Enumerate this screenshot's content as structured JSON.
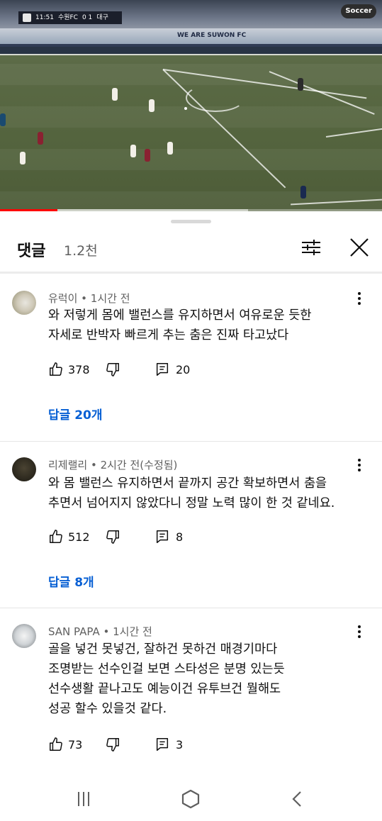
{
  "video": {
    "scorebug": {
      "time": "11:51",
      "home": "수원FC",
      "score": "0 1",
      "away": "대구"
    },
    "channel_logo": "Soccer",
    "ad_text": "WE ARE SUWON FC",
    "progress_fraction": 0.15,
    "buffered_fraction": 0.65
  },
  "sheet": {
    "title": "댓글",
    "count": "1.2천"
  },
  "comments": [
    {
      "author": "유럭이 • 1시간 전",
      "lines": [
        "와 저렇게 몸에 밸런스를 유지하면서 여유로운 듯한",
        "자세로 반박자 빠르게 추는 춤은 진짜 타고났다"
      ],
      "likes": "378",
      "reply_count": "20",
      "replies_label": "답글 20개"
    },
    {
      "author": "리제랠리 • 2시간 전(수정됨)",
      "lines": [
        "와 몸 밸런스 유지하면서 끝까지 공간 확보하면서 춤을",
        "추면서 넘어지지 않았다니 정말 노력 많이 한 것 같네요."
      ],
      "likes": "512",
      "reply_count": "8",
      "replies_label": "답글 8개"
    },
    {
      "author": "SAN PAPA • 1시간 전",
      "lines": [
        "골을 넣건 못넣건, 잘하건 못하건 매경기마다",
        "조명받는 선수인걸 보면 스타성은 분명 있는듯",
        "선수생활 끝나고도 예능이건 유투브건 뭘해도",
        "성공 할수 있을것 같다."
      ],
      "likes": "73",
      "reply_count": "3"
    }
  ],
  "colors": {
    "link_blue": "#065fd4",
    "progress_red": "#ff0000",
    "meta_gray": "#606060"
  },
  "icons": {
    "filter": "sliders-icon",
    "close": "close-icon",
    "more": "more-vertical-icon",
    "like": "thumb-up-icon",
    "dislike": "thumb-down-icon",
    "reply": "reply-icon",
    "nav_recent": "recent-apps-icon",
    "nav_home": "home-icon",
    "nav_back": "back-icon"
  }
}
